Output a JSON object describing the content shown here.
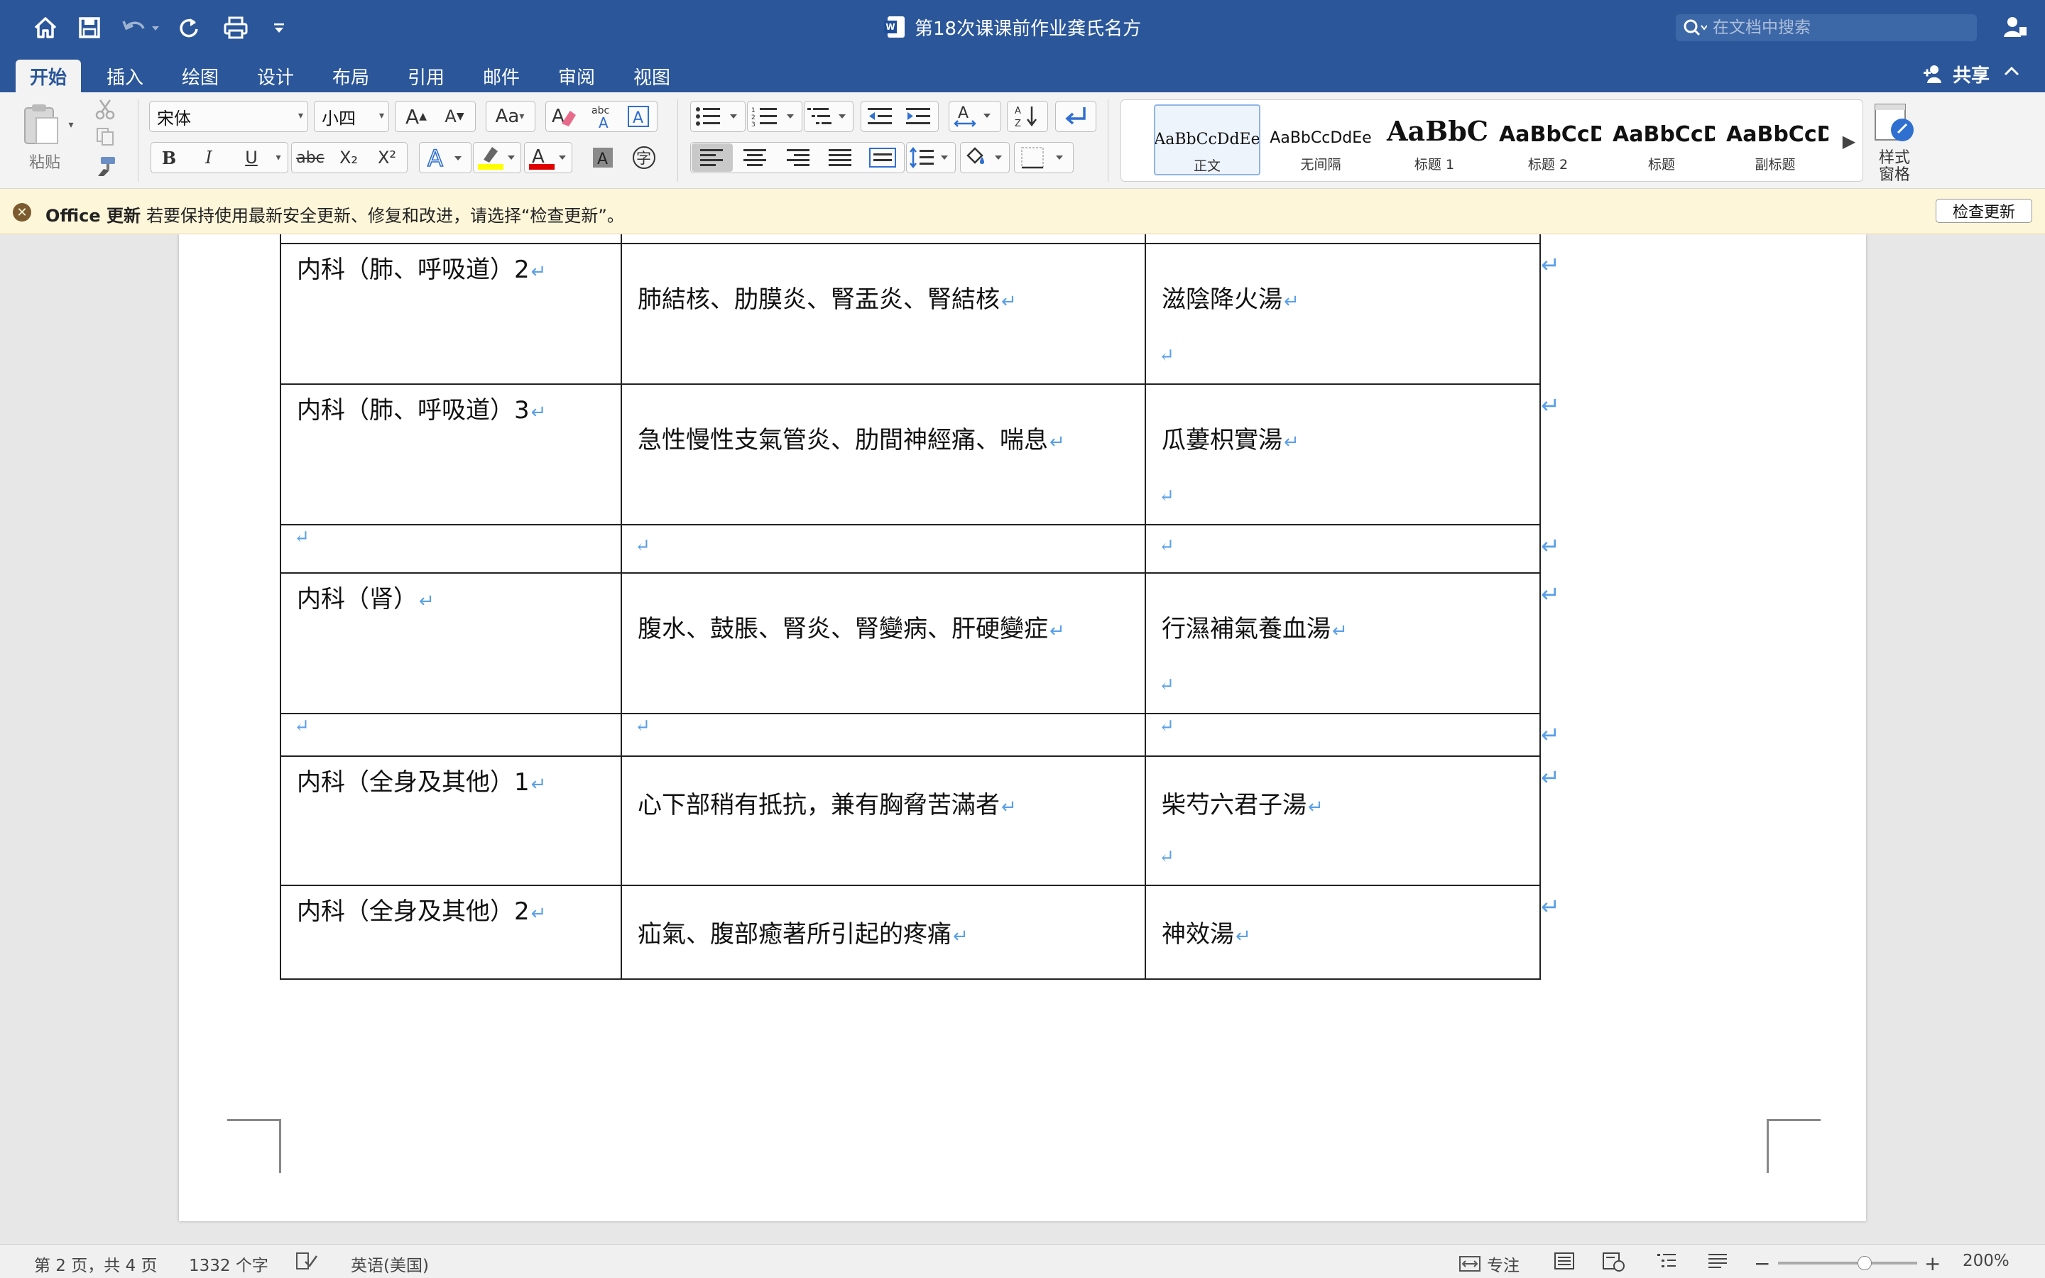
{
  "titlebar": {
    "doc_title": "第18次课课前作业龚氏名方",
    "search_placeholder": "在文档中搜索"
  },
  "tabs": [
    "开始",
    "插入",
    "绘图",
    "设计",
    "布局",
    "引用",
    "邮件",
    "审阅",
    "视图"
  ],
  "share_label": "共享",
  "ribbon": {
    "paste_label": "粘贴",
    "font_name": "宋体",
    "font_size": "小四",
    "bold": "B",
    "italic": "I",
    "underline": "U",
    "strike": "abc",
    "subscript": "X₂",
    "superscript": "X²",
    "styles": [
      {
        "sample": "AaBbCcDdEe",
        "name": "正文"
      },
      {
        "sample": "AaBbCcDdEe",
        "name": "无间隔"
      },
      {
        "sample": "AaBbCc",
        "name": "标题 1"
      },
      {
        "sample": "AaBbCcD",
        "name": "标题 2"
      },
      {
        "sample": "AaBbCcD",
        "name": "标题"
      },
      {
        "sample": "AaBbCcD",
        "name": "副标题"
      }
    ],
    "styles_pane_label": "样式\n窗格"
  },
  "notice": {
    "title": "Office 更新",
    "text": "若要保持使用最新安全更新、修复和改进，请选择“检查更新”。",
    "button": "检查更新"
  },
  "table": {
    "rows": [
      {
        "c1": "",
        "c2": "",
        "c3": ""
      },
      {
        "c1": "内科（肺、呼吸道）2",
        "c2": "肺結核、肋膜炎、腎盂炎、腎結核",
        "c3": "滋陰降火湯"
      },
      {
        "c1": "内科（肺、呼吸道）3",
        "c2": "急性慢性支氣管炎、肋間神經痛、喘息",
        "c3": "瓜蔞枳實湯"
      },
      {
        "c1": "",
        "c2": "",
        "c3": ""
      },
      {
        "c1": "内科（肾）",
        "c2": "腹水、鼓脹、腎炎、腎變病、肝硬變症",
        "c3": "行濕補氣養血湯"
      },
      {
        "c1": "",
        "c2": "",
        "c3": ""
      },
      {
        "c1": "内科（全身及其他）1",
        "c2": "心下部稍有抵抗，兼有胸脅苦滿者",
        "c3": "柴芍六君子湯"
      },
      {
        "c1": "内科（全身及其他）2",
        "c2": "疝氣、腹部癒著所引起的疼痛",
        "c3": "神效湯"
      }
    ]
  },
  "statusbar": {
    "page": "第 2 页，共 4 页",
    "words": "1332 个字",
    "language": "英语(美国)",
    "focus": "专注",
    "zoom": "200%"
  }
}
